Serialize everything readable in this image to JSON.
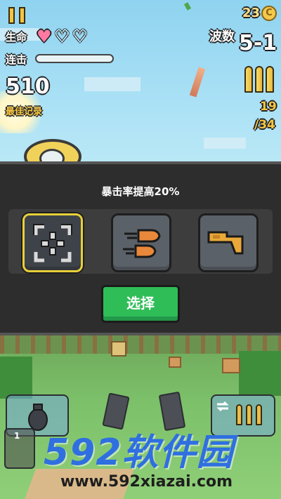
{
  "hud": {
    "coins": "23",
    "coin_symbol": "C",
    "life_label": "生命",
    "hearts": [
      "♥",
      "♡",
      "♡"
    ],
    "heart_colors": [
      "#ff7aa2",
      "#ffffff",
      "#ffffff"
    ],
    "combo_label": "连击",
    "combo_progress": 0,
    "score": "510",
    "best_label": "最佳记录",
    "wave_label": "波数",
    "wave_value": "5-1",
    "ammo_clip": "19",
    "ammo_total": "/34"
  },
  "modal": {
    "title": "暴击率提高20%",
    "options": [
      {
        "icon": "crosshair-icon",
        "selected": true
      },
      {
        "icon": "speed-bullets-icon",
        "selected": false
      },
      {
        "icon": "gun-stock-icon",
        "selected": false
      }
    ],
    "select_label": "选择"
  },
  "bottom": {
    "ability_count": "1"
  },
  "watermark": {
    "logo": "592软件园",
    "url": "www.592xiazai.com"
  },
  "colors": {
    "accent_yellow": "#f5c542",
    "select_green": "#2fbd57",
    "selected_border": "#e8cf3a",
    "watermark_blue": "#2f6fe0"
  }
}
